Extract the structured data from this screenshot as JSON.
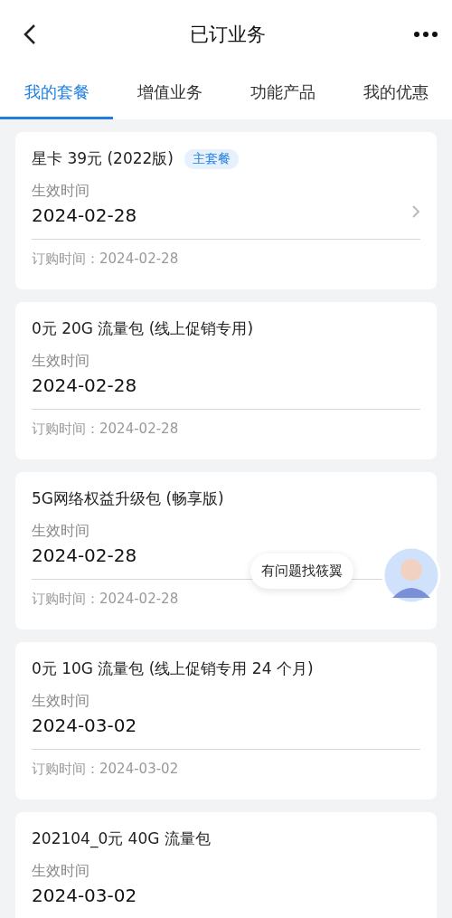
{
  "header": {
    "title": "已订业务"
  },
  "tabs": [
    {
      "label": "我的套餐",
      "selected": true
    },
    {
      "label": "增值业务",
      "selected": false
    },
    {
      "label": "功能产品",
      "selected": false
    },
    {
      "label": "我的优惠",
      "selected": false
    }
  ],
  "cards": [
    {
      "title": "星卡 39元 (2022版)",
      "badge": "主套餐",
      "arrow": true,
      "effective_label": "生效时间",
      "effective_date": "2024-02-28",
      "order_text": "订购时间：2024-02-28"
    },
    {
      "title": "0元 20G 流量包 (线上促销专用)",
      "arrow": false,
      "effective_label": "生效时间",
      "effective_date": "2024-02-28",
      "order_text": "订购时间：2024-02-28"
    },
    {
      "title": "5G网络权益升级包 (畅享版)",
      "arrow": false,
      "effective_label": "生效时间",
      "effective_date": "2024-02-28",
      "order_text": "订购时间：2024-02-28"
    },
    {
      "title": "0元 10G 流量包 (线上促销专用 24 个月)",
      "arrow": false,
      "effective_label": "生效时间",
      "effective_date": "2024-03-02",
      "order_text": "订购时间：2024-03-02"
    },
    {
      "title": "202104_0元 40G 流量包",
      "arrow": false,
      "effective_label": "生效时间",
      "effective_date": "2024-03-02"
    }
  ],
  "assistant": {
    "bubble": "有问题找筱翼"
  }
}
